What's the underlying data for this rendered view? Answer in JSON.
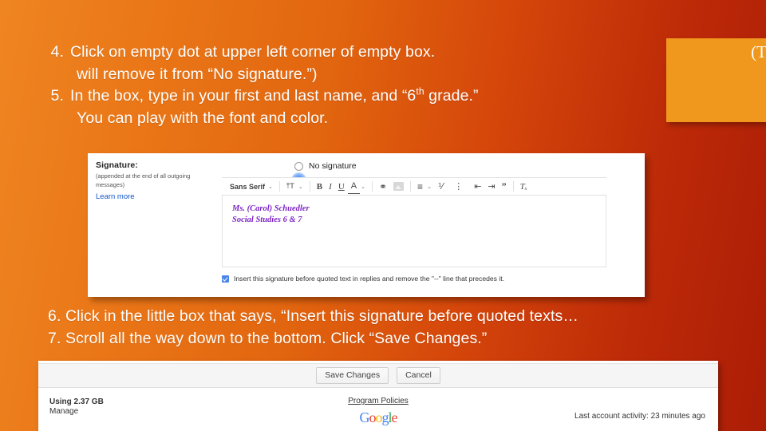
{
  "slide": {
    "background_gradient_from": "#ef8521",
    "background_gradient_to": "#ab1d06"
  },
  "callout": {
    "text": "(T",
    "color": "#f0981e"
  },
  "instructions_top": [
    {
      "number": "4.",
      "text": "Click on empty dot at upper left corner of empty box.",
      "continuation": "will remove it from “No signature.”)"
    },
    {
      "number": "5.",
      "text_before_sup": "In the box, type in your first and last name, and “6",
      "sup": "th",
      "text_after_sup": " grade.”",
      "continuation": "You can play with the font and color."
    }
  ],
  "instructions_bottom": [
    {
      "number": "6.",
      "text": "Click in the little box that says, “Insert this signature before quoted texts…"
    },
    {
      "number": "7.",
      "text": "Scroll all the way down to the bottom.  Click “Save Changes.”"
    }
  ],
  "signature_panel": {
    "label_title": "Signature:",
    "label_sub": "(appended at the end of all outgoing messages)",
    "label_link": "Learn more",
    "radio_no_signature": "No signature",
    "radio_selected_value": "signature-editor",
    "toolbar": {
      "font_name": "Sans Serif",
      "font_caret": "⌄",
      "size_icon": "⤒T",
      "size_caret": "⌄",
      "bold": "B",
      "italic": "I",
      "underline": "U",
      "text_color": "A",
      "color_caret": "⌄",
      "link": "⚭",
      "image": "image-icon",
      "align": "≡",
      "align_caret": "⌄",
      "numbered_list": "⅟",
      "more": "⋮",
      "indent_less": "⇤",
      "indent_more": "⇥",
      "quote": "”",
      "remove_formatting": "Tₓ"
    },
    "signature_lines": [
      "Ms. (Carol) Schuedler",
      "Social Studies 6 & 7"
    ],
    "signature_text_color": "#7b24c4",
    "checkbox_checked": true,
    "checkbox_label": "Insert this signature before quoted text in replies and remove the \"--\" line that precedes it."
  },
  "footer_panel": {
    "save_button": "Save Changes",
    "cancel_button": "Cancel",
    "storage_used": "Using 2.37 GB",
    "manage_link": "Manage",
    "program_policies": "Program Policies",
    "logo_letters": [
      "G",
      "o",
      "o",
      "g",
      "l",
      "e"
    ],
    "last_activity": "Last account activity: 23 minutes ago"
  }
}
